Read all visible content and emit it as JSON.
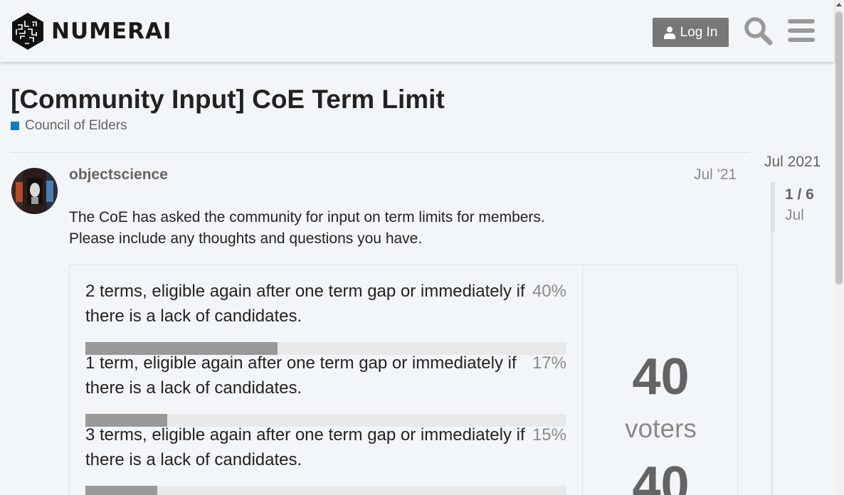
{
  "header": {
    "logo_text": "NUMERAI",
    "login_label": "Log In",
    "search_icon": "search-icon",
    "menu_icon": "hamburger-menu-icon"
  },
  "topic": {
    "title": "[Community Input] CoE Term Limit",
    "category": "Council of Elders",
    "category_color": "#0e7fc1"
  },
  "post": {
    "username": "objectscience",
    "date": "Jul '21",
    "body_lines": [
      "The CoE has asked the community for input on term limits for members.",
      "Please include any thoughts and questions you have."
    ]
  },
  "poll": {
    "options": [
      {
        "text": "2 terms, eligible again after one term gap or immediately if there is a lack of candidates.",
        "percent_label": "40%",
        "percent": 40
      },
      {
        "text": "1 term, eligible again after one term gap or immediately if there is a lack of candidates.",
        "percent_label": "17%",
        "percent": 17
      },
      {
        "text": "3 terms, eligible again after one term gap or immediately if there is a lack of candidates.",
        "percent_label": "15%",
        "percent": 15
      }
    ],
    "voters_count": "40",
    "voters_label": "voters",
    "voters_count_second": "40"
  },
  "timeline": {
    "start_date": "Jul 2021",
    "position": "1 / 6",
    "current_date": "Jul"
  },
  "colors": {
    "accent": "#0e7fc1",
    "button_bg": "#777777",
    "bar_fill": "#999999",
    "bar_bg": "#e9e9e9"
  }
}
